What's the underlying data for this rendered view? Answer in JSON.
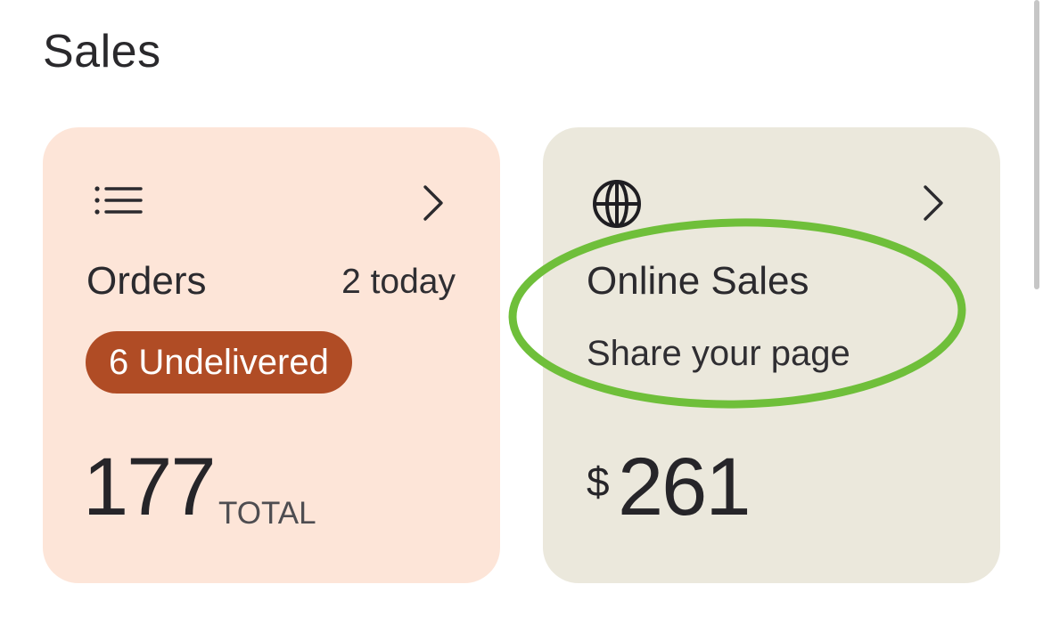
{
  "header": {
    "title": "Sales"
  },
  "orders_card": {
    "icon": "list-icon",
    "chevron": "chevron-right-icon",
    "title": "Orders",
    "today": "2 today",
    "badge": "6 Undelivered",
    "total_value": "177",
    "total_label": "TOTAL",
    "background": "#fde5d8",
    "badge_color": "#b04c25"
  },
  "online_card": {
    "icon": "globe-icon",
    "chevron": "chevron-right-icon",
    "title": "Online Sales",
    "subtitle": "Share your page",
    "currency": "$",
    "amount": "261",
    "background": "#ebe8dc"
  },
  "annotation": {
    "shape": "ellipse",
    "color": "#6fbf3a"
  }
}
